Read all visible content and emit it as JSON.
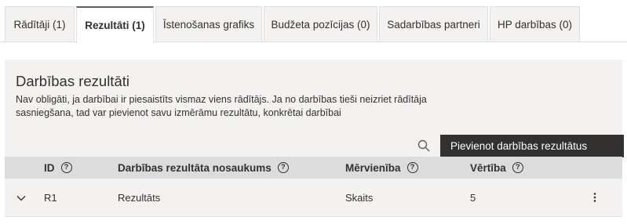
{
  "tabs": [
    {
      "label": "Rādītāji (1)"
    },
    {
      "label": "Rezultāti (1)"
    },
    {
      "label": "Īstenošanas grafiks"
    },
    {
      "label": "Budžeta pozīcijas (0)"
    },
    {
      "label": "Sadarbības partneri"
    },
    {
      "label": "HP darbības (0)"
    }
  ],
  "section": {
    "title": "Darbības rezultāti",
    "description": "Nav obligāti, ja darbībai ir piesaistīts vismaz viens rādītājs. Ja no darbības tieši neizriet rādītāja sasniegšana, tad var pievienot savu izmērāmu rezultātu, konkrētai darbībai"
  },
  "toolbar": {
    "search_icon": "search-icon",
    "add_button_label": "Pievienot darbības rezultātus"
  },
  "table": {
    "columns": [
      {
        "label": "ID",
        "help": "?"
      },
      {
        "label": "Darbības rezultāta nosaukums",
        "help": "?"
      },
      {
        "label": "Mērvienība",
        "help": "?"
      },
      {
        "label": "Vērtība",
        "help": "?"
      }
    ],
    "rows": [
      {
        "id": "R1",
        "name": "Rezultāts",
        "unit": "Skaits",
        "value": "5"
      }
    ]
  },
  "colors": {
    "panel_bg": "#f3f2f1",
    "header_bg": "#dcdcdc",
    "button_bg": "#323130",
    "text": "#323130"
  }
}
